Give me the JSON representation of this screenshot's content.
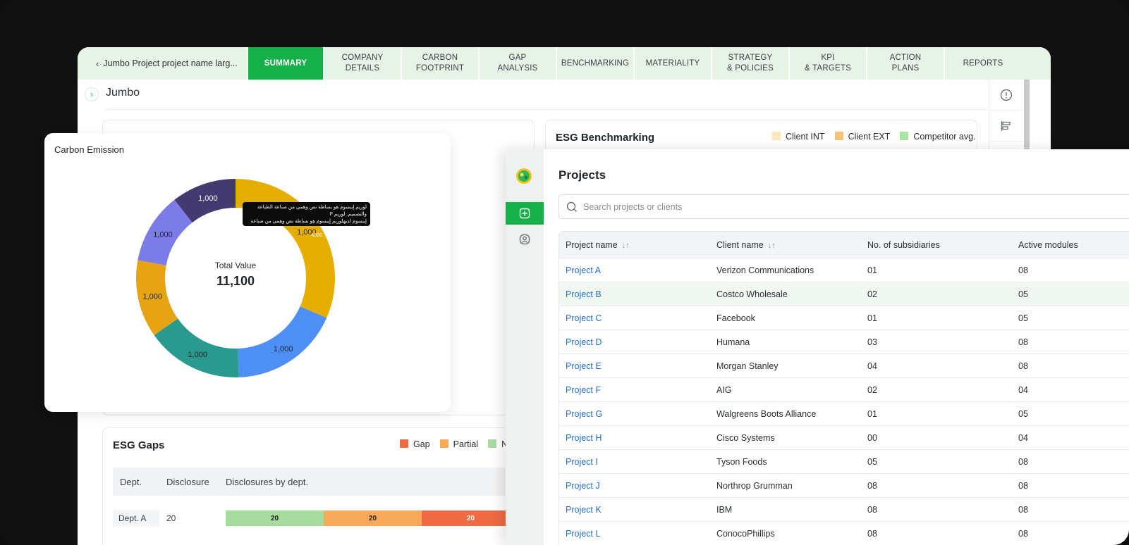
{
  "app": {
    "back_label": "Jumbo Project project name larg...",
    "tabs": [
      {
        "label": "SUMMARY",
        "active": true
      },
      {
        "label": "COMPANY\nDETAILS"
      },
      {
        "label": "CARBON\nFOOTPRINT"
      },
      {
        "label": "GAP\nANALYSIS"
      },
      {
        "label": "BENCHMARKING"
      },
      {
        "label": "MATERIALITY"
      },
      {
        "label": "STRATEGY\n& POLICIES"
      },
      {
        "label": "KPI\n& TARGETS"
      },
      {
        "label": "ACTION\nPLANS"
      },
      {
        "label": "REPORTS"
      }
    ],
    "page_title": "Jumbo"
  },
  "benchmarking": {
    "title": "ESG Benchmarking",
    "legend": [
      {
        "label": "Client INT",
        "color": "#fbe9b9"
      },
      {
        "label": "Client EXT",
        "color": "#f6c27a"
      },
      {
        "label": "Competitor avg.",
        "color": "#a8e6a3"
      }
    ]
  },
  "gaps": {
    "title": "ESG Gaps",
    "legend": [
      {
        "label": "Gap",
        "color": "#ee6b44"
      },
      {
        "label": "Partial",
        "color": "#f8a95a"
      },
      {
        "label": "No",
        "color": "#a8dba0"
      }
    ],
    "columns": [
      "Dept.",
      "Disclosure",
      "Disclosures by dept."
    ],
    "rows": [
      {
        "dept": "Dept. A",
        "disclosure": "20",
        "bars": [
          "20",
          "20",
          "20"
        ]
      }
    ]
  },
  "carbon": {
    "title": "Carbon Emission",
    "center_label": "Total Value",
    "center_value": "11,100",
    "tooltip_lines": [
      "لوريم إيبسوم هو بساطة نص وهمي من صناعة الطباعة والتصميم. لوريم F",
      "إيبسوم لديهلوريم إيبسوم هو بساطة نص وهمي من صناعة الطباعة والتصميم.",
      "لوريم إيبسوم لديه 5 : 4000"
    ],
    "chart_data": {
      "type": "pie",
      "variant": "donut",
      "slices": [
        {
          "label": "1,000",
          "value": 3,
          "color": "#e6ae00"
        },
        {
          "label": "1,000",
          "value": 1.7,
          "color": "#4d8ff5"
        },
        {
          "label": "1,000",
          "value": 1.5,
          "color": "#2a9a8f"
        },
        {
          "label": "1,000",
          "value": 1.2,
          "color": "#e6a414"
        },
        {
          "label": "1,000",
          "value": 1.1,
          "color": "#7c7ce8"
        },
        {
          "label": "1,000",
          "value": 1.0,
          "color": "#433a6f"
        }
      ]
    }
  },
  "projects": {
    "title": "Projects",
    "search_placeholder": "Search projects or clients",
    "columns": [
      "Project name",
      "Client name",
      "No. of subsidiaries",
      "Active modules"
    ],
    "rows": [
      {
        "name": "Project A",
        "client": "Verizon Communications",
        "subs": "01",
        "modules": "08"
      },
      {
        "name": "Project B",
        "client": "Costco Wholesale",
        "subs": "02",
        "modules": "05",
        "highlight": true
      },
      {
        "name": "Project C",
        "client": "Facebook",
        "subs": "01",
        "modules": "05"
      },
      {
        "name": "Project D",
        "client": "Humana",
        "subs": "03",
        "modules": "08"
      },
      {
        "name": "Project E",
        "client": "Morgan Stanley",
        "subs": "04",
        "modules": "08"
      },
      {
        "name": "Project F",
        "client": "AIG",
        "subs": "02",
        "modules": "04"
      },
      {
        "name": "Project G",
        "client": "Walgreens Boots Alliance",
        "subs": "01",
        "modules": "05"
      },
      {
        "name": "Project H",
        "client": "Cisco Systems",
        "subs": "00",
        "modules": "04"
      },
      {
        "name": "Project I",
        "client": "Tyson Foods",
        "subs": "05",
        "modules": "08"
      },
      {
        "name": "Project J",
        "client": "Northrop Grumman",
        "subs": "08",
        "modules": "08"
      },
      {
        "name": "Project K",
        "client": "IBM",
        "subs": "08",
        "modules": "08"
      },
      {
        "name": "Project L",
        "client": "ConocoPhillips",
        "subs": "08",
        "modules": "08"
      }
    ]
  }
}
